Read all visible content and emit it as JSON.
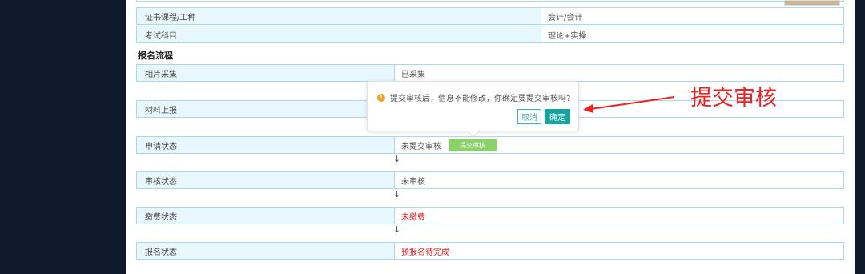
{
  "info_rows": [
    {
      "label": "证书课程/工种",
      "value": "会计/会计"
    },
    {
      "label": "考试科目",
      "value": "理论+实操"
    }
  ],
  "section_title": "报名流程",
  "flow_rows": [
    {
      "label": "相片采集",
      "value": "已采集"
    },
    {
      "label": "材料上报",
      "value": ""
    },
    {
      "label": "申请状态",
      "value": "未提交审核",
      "button": "提交审核"
    },
    {
      "label": "审核状态",
      "value": "未审核"
    },
    {
      "label": "缴费状态",
      "value": "未缴费"
    },
    {
      "label": "报名状态",
      "value": "预报名待完成"
    }
  ],
  "arrow_glyph": "↓",
  "popover": {
    "message": "提交审核后，信息不能修改，你确定要提交审核吗?",
    "cancel_label": "取消",
    "ok_label": "确定"
  },
  "annotation": "提交审核",
  "colors": {
    "sidebar": "#0f1b2c",
    "label_bg": "#e8f6fd",
    "border": "#a8d8ea",
    "status_red": "#e02020",
    "submit_green": "#8bd16a",
    "accent_teal": "#17a4a0",
    "annotation_red": "#ee2222"
  }
}
